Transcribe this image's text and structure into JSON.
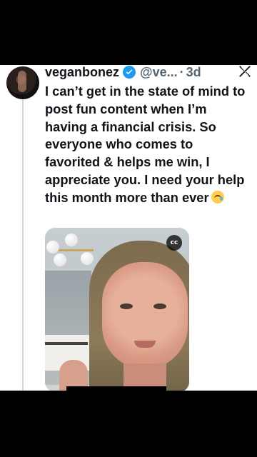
{
  "tweet": {
    "display_name": "veganbonez",
    "handle": "@ve...",
    "separator": "·",
    "timestamp": "3d",
    "text": "I can’t get in the state of mind to post fun content when I’m having a financial crisis. So everyone who comes to favorited & helps me win, I appreciate you. I need your help this month more than ever",
    "emoji": "crying-face",
    "media": {
      "captions_label": "cc"
    }
  },
  "colors": {
    "verified": "#1d9bf0",
    "text": "#0f1419",
    "muted": "#536471"
  }
}
